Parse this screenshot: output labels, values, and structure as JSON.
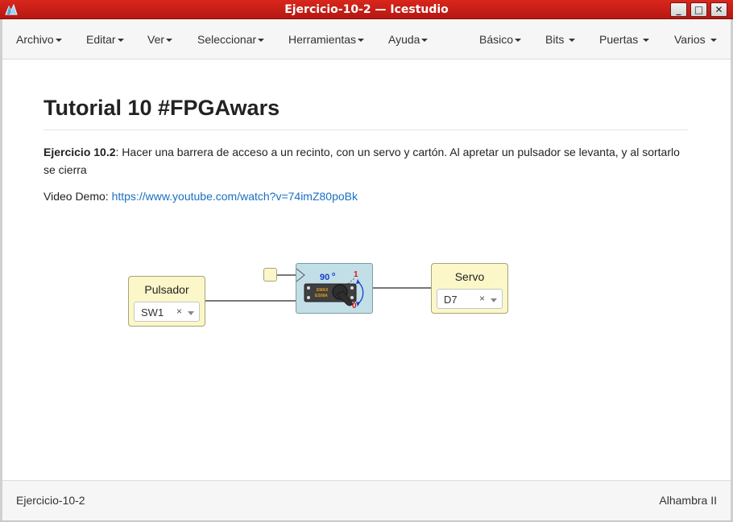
{
  "window": {
    "title": "Ejercicio-10-2 — Icestudio",
    "minimize": "_",
    "maximize": "□",
    "close": "✕"
  },
  "menu": {
    "left": [
      {
        "label": "Archivo"
      },
      {
        "label": "Editar"
      },
      {
        "label": "Ver"
      },
      {
        "label": "Seleccionar"
      },
      {
        "label": "Herramientas"
      },
      {
        "label": "Ayuda"
      }
    ],
    "right": [
      {
        "label": "Básico"
      },
      {
        "label": "Bits "
      },
      {
        "label": "Puertas "
      },
      {
        "label": "Varios "
      }
    ]
  },
  "doc": {
    "title": "Tutorial 10 #FPGAwars",
    "exercise_label": "Ejercicio 10.2",
    "exercise_text": ": Hacer una barrera de acceso a un recinto, con un servo y cartón. Al apretar un pulsador se levanta, y al sortarlo se cierra",
    "video_label": "Video Demo: ",
    "video_link": "https://www.youtube.com/watch?v=74imZ80poBk"
  },
  "diagram": {
    "input_block": {
      "title": "Pulsador",
      "value": "SW1",
      "clear": "×"
    },
    "output_block": {
      "title": "Servo",
      "value": "D7",
      "clear": "×"
    },
    "servo": {
      "angle": "90",
      "unit": "o",
      "high": "1",
      "low": "0",
      "brand_line1": "EMAX",
      "brand_line2": "ES08A"
    }
  },
  "footer": {
    "file": "Ejercicio-10-2",
    "board": "Alhambra II"
  },
  "colors": {
    "titlebar": "#c81f17",
    "block_yellow": "#fbf7c8",
    "servo_block": "#c2dfe8",
    "link": "#1a6fc2"
  }
}
